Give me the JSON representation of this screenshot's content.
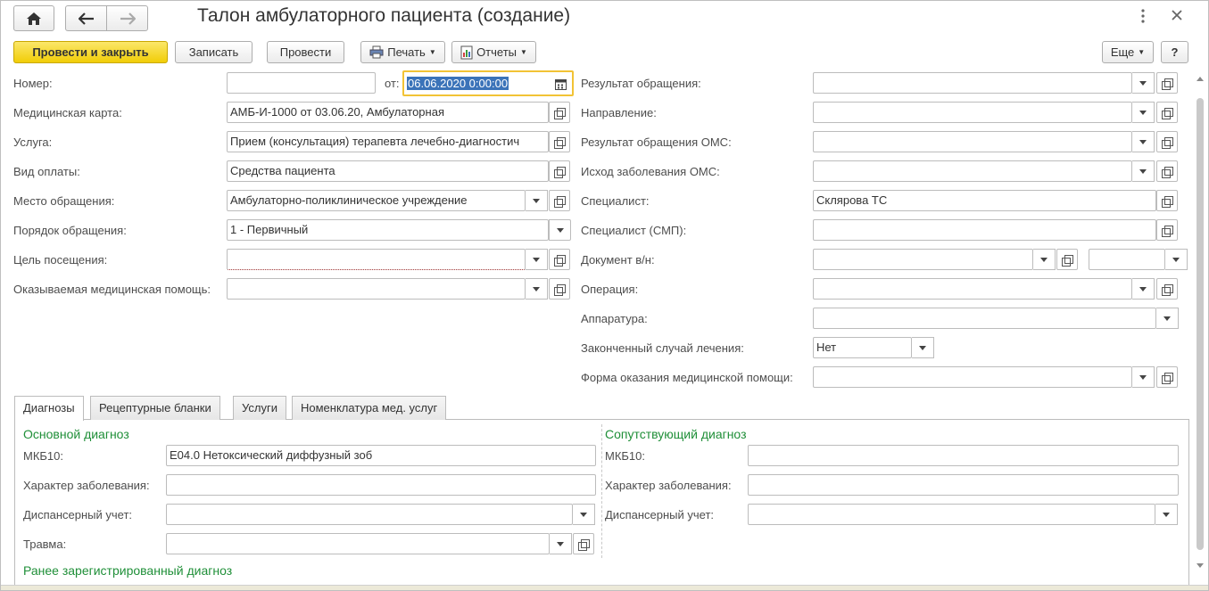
{
  "window": {
    "title": "Талон амбулаторного пациента (создание)",
    "menu_icon": "vertical-dots-icon",
    "close_icon": "close-icon"
  },
  "toolbar": {
    "post_close": "Провести и закрыть",
    "save": "Записать",
    "post": "Провести",
    "print": "Печать",
    "reports": "Отчеты",
    "more": "Еще",
    "help": "?"
  },
  "left": {
    "number_label": "Номер:",
    "number_value": "",
    "date_from_label": "от:",
    "date_value": "06.06.2020  0:00:00",
    "med_card_label": "Медицинская карта:",
    "med_card_value": "АМБ-И-1000 от 03.06.20, Амбулаторная",
    "service_label": "Услуга:",
    "service_value": "Прием (консультация) терапевта лечебно-диагностич",
    "payment_label": "Вид оплаты:",
    "payment_value": "Средства пациента",
    "place_label": "Место обращения:",
    "place_value": "Амбулаторно-поликлиническое учреждение",
    "order_label": "Порядок обращения:",
    "order_value": "1 - Первичный",
    "purpose_label": "Цель посещения:",
    "purpose_value": "",
    "care_label": "Оказываемая медицинская помощь:",
    "care_value": ""
  },
  "right": {
    "result_label": "Результат обращения:",
    "direction_label": "Направление:",
    "result_oms_label": "Результат обращения ОМС:",
    "outcome_oms_label": "Исход заболевания ОМС:",
    "specialist_label": "Специалист:",
    "specialist_value": "Склярова ТС",
    "specialist_smp_label": "Специалист (СМП):",
    "document_label": "Документ в/н:",
    "operation_label": "Операция:",
    "equipment_label": "Аппаратура:",
    "finished_label": "Законченный случай лечения:",
    "finished_value": "Нет",
    "care_form_label": "Форма оказания медицинской помощи:"
  },
  "tabs": [
    {
      "label": "Диагнозы"
    },
    {
      "label": "Рецептурные бланки"
    },
    {
      "label": "Услуги"
    },
    {
      "label": "Номенклатура мед. услуг"
    }
  ],
  "diagnoses": {
    "main_title": "Основной диагноз",
    "mkb_label": "МКБ10:",
    "mkb_value": "E04.0 Нетоксический диффузный зоб",
    "character_label": "Характер заболевания:",
    "dispensary_label": "Диспансерный учет:",
    "trauma_label": "Травма:",
    "concomitant_title": "Сопутствующий диагноз",
    "c_mkb_label": "МКБ10:",
    "c_character_label": "Характер заболевания:",
    "c_dispensary_label": "Диспансерный учет:",
    "previous_title": "Ранее зарегистрированный диагноз"
  },
  "colors": {
    "primary_button": "#f1cd07",
    "group_title": "#1f8f38",
    "focus_border": "#f2c335",
    "selection": "#3b73b9"
  }
}
